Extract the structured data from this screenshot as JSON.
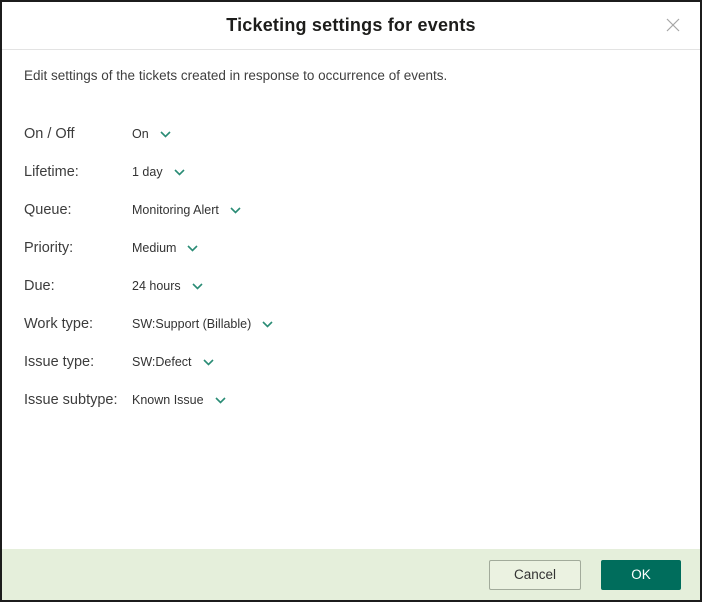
{
  "dialog": {
    "title": "Ticketing settings for events",
    "description": "Edit settings of the tickets created in response to occurrence of events."
  },
  "settings": {
    "rows": [
      {
        "label": "On / Off",
        "value": "On"
      },
      {
        "label": "Lifetime:",
        "value": "1 day"
      },
      {
        "label": "Queue:",
        "value": "Monitoring Alert"
      },
      {
        "label": "Priority:",
        "value": "Medium"
      },
      {
        "label": "Due:",
        "value": "24 hours"
      },
      {
        "label": "Work type:",
        "value": "SW:Support (Billable)"
      },
      {
        "label": "Issue type:",
        "value": "SW:Defect"
      },
      {
        "label": "Issue subtype:",
        "value": "Known Issue"
      }
    ]
  },
  "footer": {
    "cancel_label": "Cancel",
    "ok_label": "OK"
  },
  "icons": {
    "close": "close-icon",
    "chevron_down": "chevron-down-icon"
  },
  "colors": {
    "accent_chevron_green": "#2a8c75",
    "ok_button_bg": "#006d5c",
    "footer_bg": "#e5efdb",
    "dialog_border": "#1c1c1c",
    "header_separator": "#e3e3e3",
    "close_icon_gray": "#a6a6a6"
  }
}
